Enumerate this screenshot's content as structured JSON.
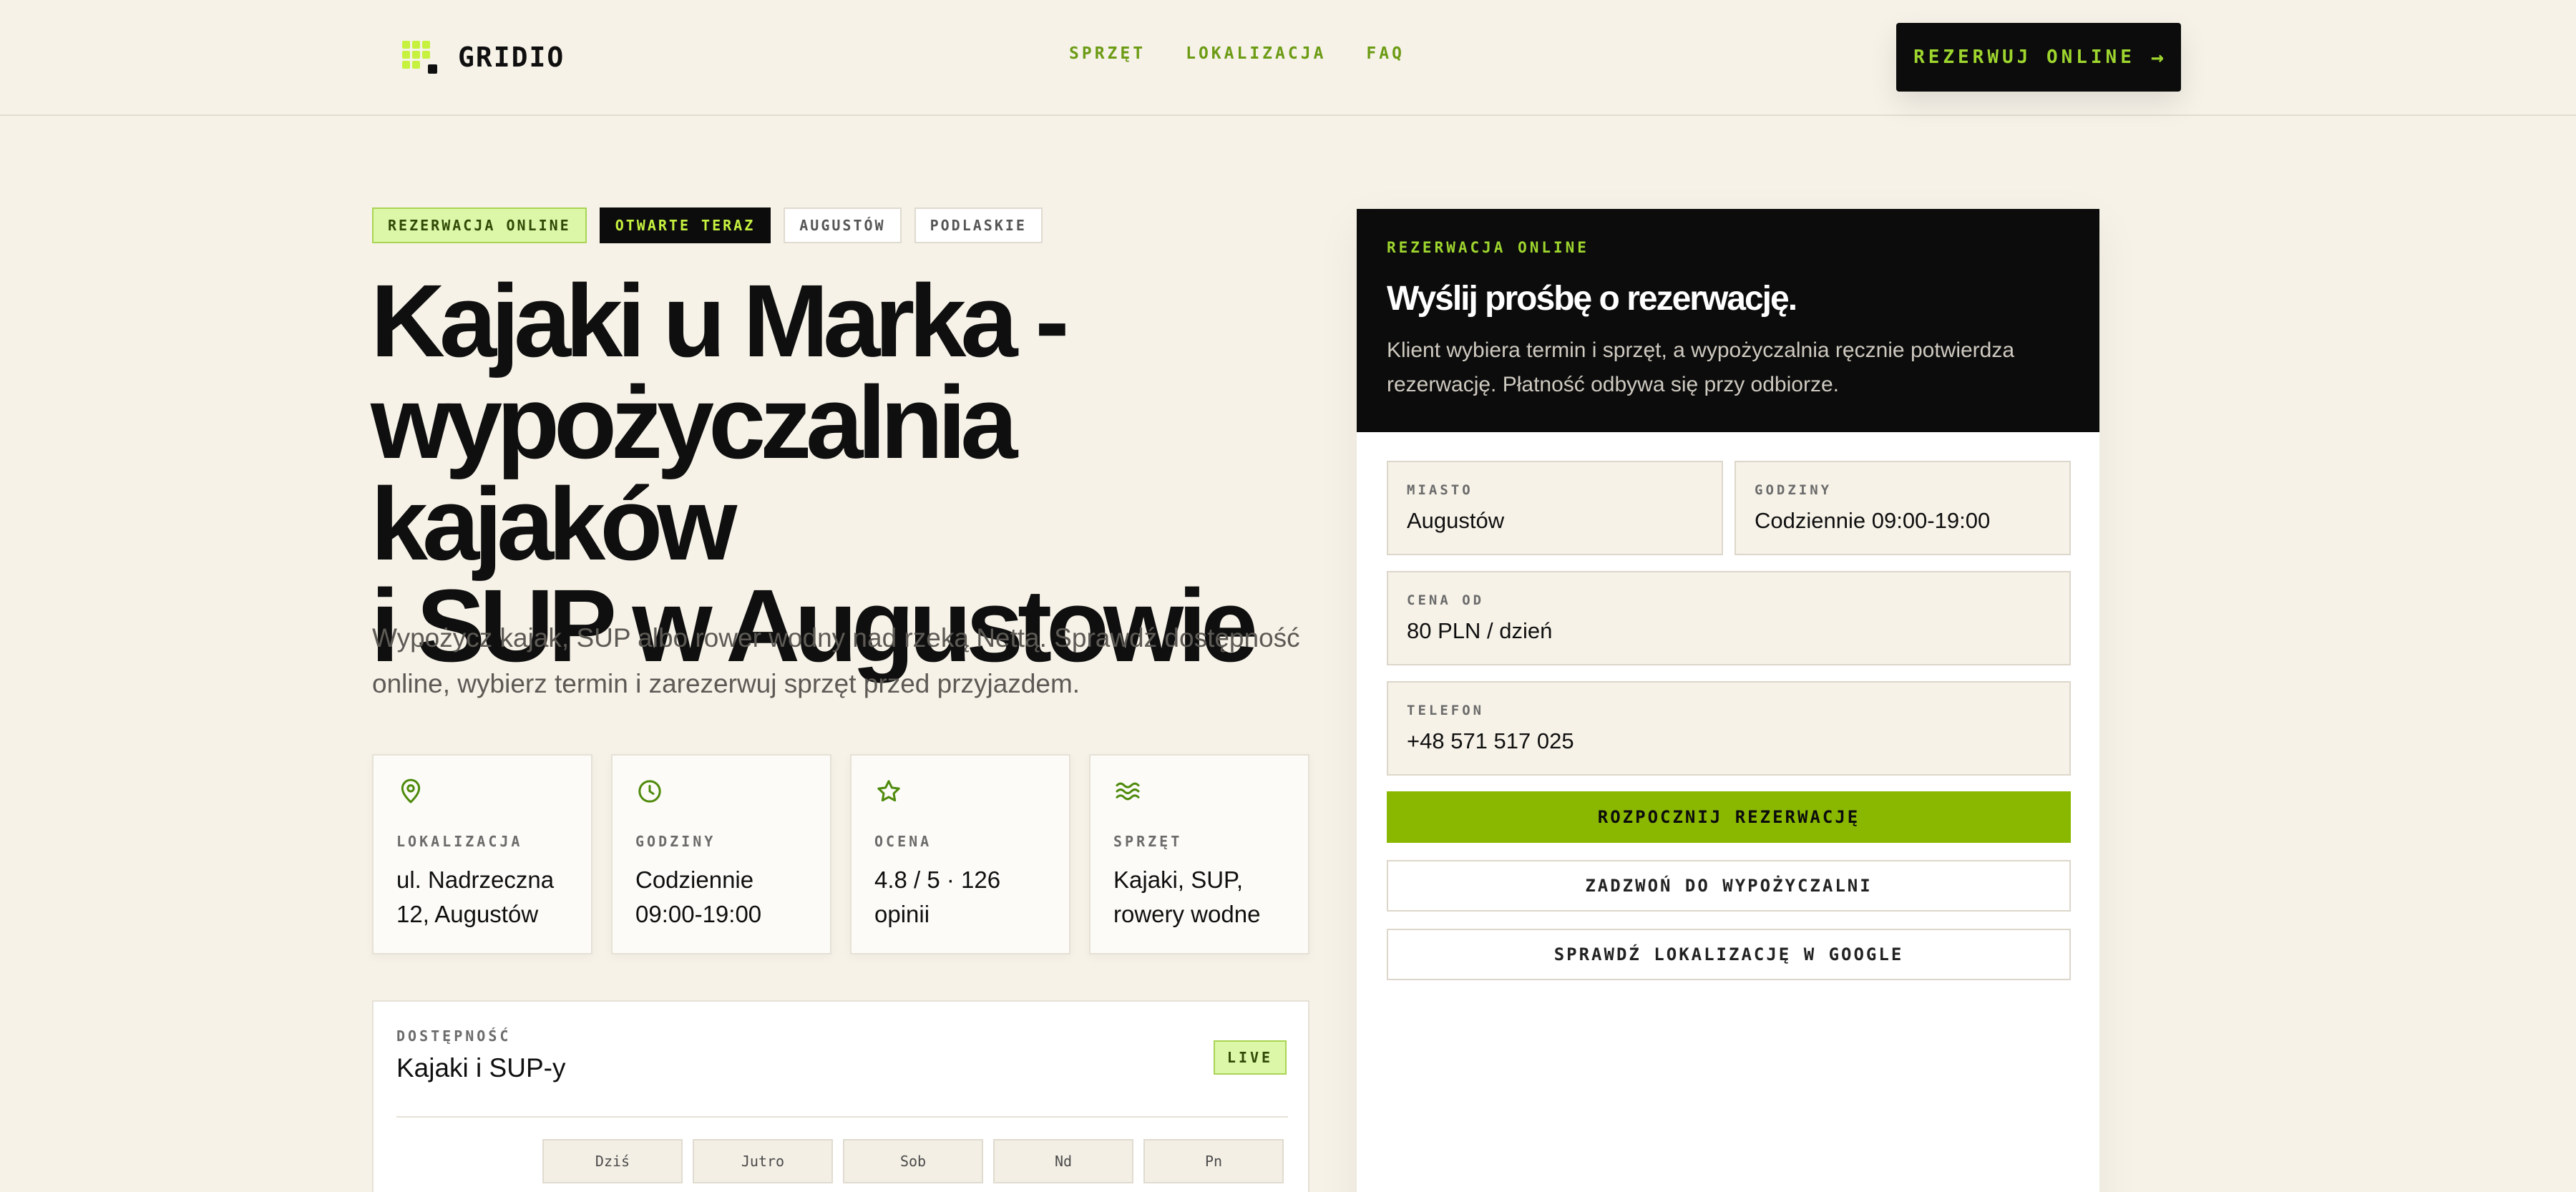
{
  "brand": {
    "name": "GRIDIO"
  },
  "nav": {
    "links": [
      "SPRZĘT",
      "LOKALIZACJA",
      "FAQ"
    ],
    "cta_label": "REZERWUJ ONLINE",
    "cta_icon": "arrow-right-icon"
  },
  "tags": [
    "REZERWACJA ONLINE",
    "OTWARTE TERAZ",
    "AUGUSTÓW",
    "PODLASKIE"
  ],
  "hero": {
    "title_line1": "Kajaki u Marka -",
    "title_line2": "wypożyczalnia kajaków",
    "title_line3": "i SUP w Augustowie",
    "subtitle": "Wypożycz kajak, SUP albo rower wodny nad rzeką Nettą. Sprawdź dostępność online, wybierz termin i zarezerwuj sprzęt przed przyjazdem."
  },
  "info_cards": [
    {
      "icon": "location-pin-icon",
      "label": "LOKALIZACJA",
      "value": "ul. Nadrzeczna 12, Augustów"
    },
    {
      "icon": "clock-icon",
      "label": "GODZINY",
      "value": "Codziennie 09:00-19:00"
    },
    {
      "icon": "star-icon",
      "label": "OCENA",
      "value": "4.8 / 5 · 126 opinii"
    },
    {
      "icon": "waves-icon",
      "label": "SPRZĘT",
      "value": "Kajaki, SUP, rowery wodne"
    }
  ],
  "availability": {
    "label": "DOSTĘPNOŚĆ",
    "title": "Kajaki i SUP-y",
    "badge": "LIVE",
    "days": [
      "Dziś",
      "Jutro",
      "Sob",
      "Nd",
      "Pn"
    ]
  },
  "booking": {
    "eyebrow": "REZERWACJA ONLINE",
    "title": "Wyślij prośbę o rezerwację.",
    "description": "Klient wybiera termin i sprzęt, a wypożyczalnia ręcznie potwierdza rezerwację. Płatność odbywa się przy odbiorze.",
    "fields": {
      "city": {
        "label": "MIASTO",
        "value": "Augustów"
      },
      "hours": {
        "label": "GODZINY",
        "value": "Codziennie 09:00-19:00"
      },
      "price": {
        "label": "CENA OD",
        "value": "80 PLN / dzień"
      },
      "phone": {
        "label": "TELEFON",
        "value": "+48 571 517 025"
      }
    },
    "primary_button": "ROZPOCZNIJ REZERWACJĘ",
    "call_button": "ZADZWOŃ DO WYPOŻYCZALNI",
    "map_button": "SPRAWDŹ LOKALIZACJĘ W GOOGLE"
  },
  "colors": {
    "background": "#f6f2e8",
    "accent": "#8ab800",
    "accent_light": "#c6f23f",
    "dark": "#0c0c0c"
  }
}
